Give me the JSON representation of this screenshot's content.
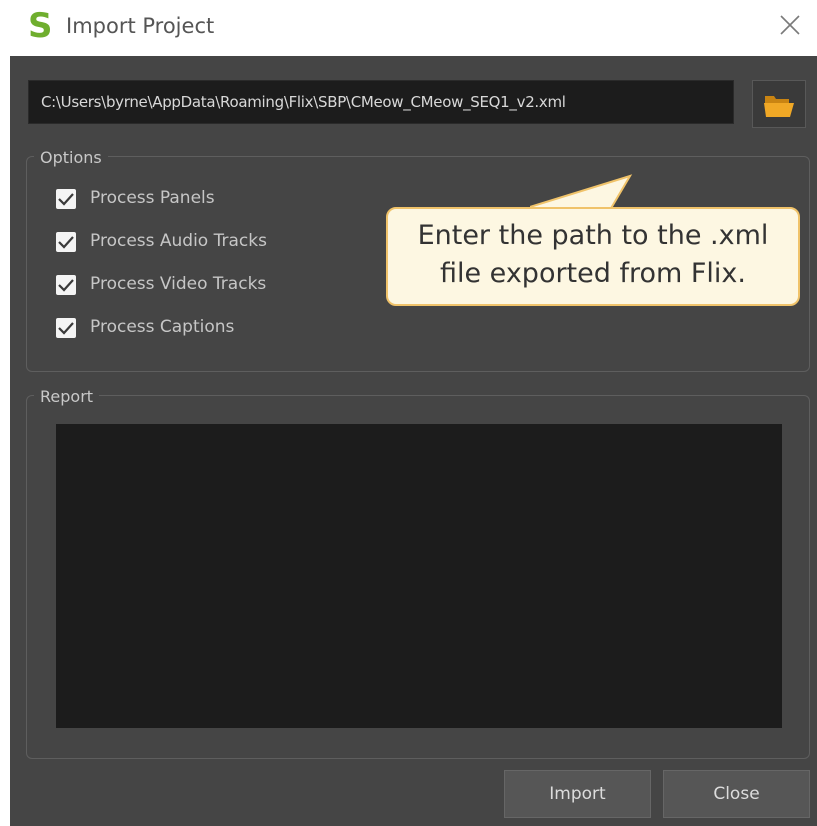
{
  "window": {
    "title": "Import Project",
    "logo_letter": "S",
    "logo_color": "#6fae2e",
    "close_icon": "close-icon"
  },
  "path": {
    "value": "C:\\Users\\byrne\\AppData\\Roaming\\Flix\\SBP\\CMeow_CMeow_SEQ1_v2.xml",
    "browse_icon": "folder-open-icon",
    "folder_color": "#f0a826"
  },
  "options": {
    "title": "Options",
    "items": [
      {
        "label": "Process Panels",
        "checked": true
      },
      {
        "label": "Process Audio Tracks",
        "checked": true
      },
      {
        "label": "Process Video Tracks",
        "checked": true
      },
      {
        "label": "Process Captions",
        "checked": true
      }
    ]
  },
  "report": {
    "title": "Report",
    "content": ""
  },
  "buttons": {
    "import_label": "Import",
    "close_label": "Close"
  },
  "callout": {
    "line1": "Enter the path to the .xml",
    "line2": "file exported from Flix.",
    "border_color": "#f0c36a",
    "background": "#fdf7e2"
  }
}
